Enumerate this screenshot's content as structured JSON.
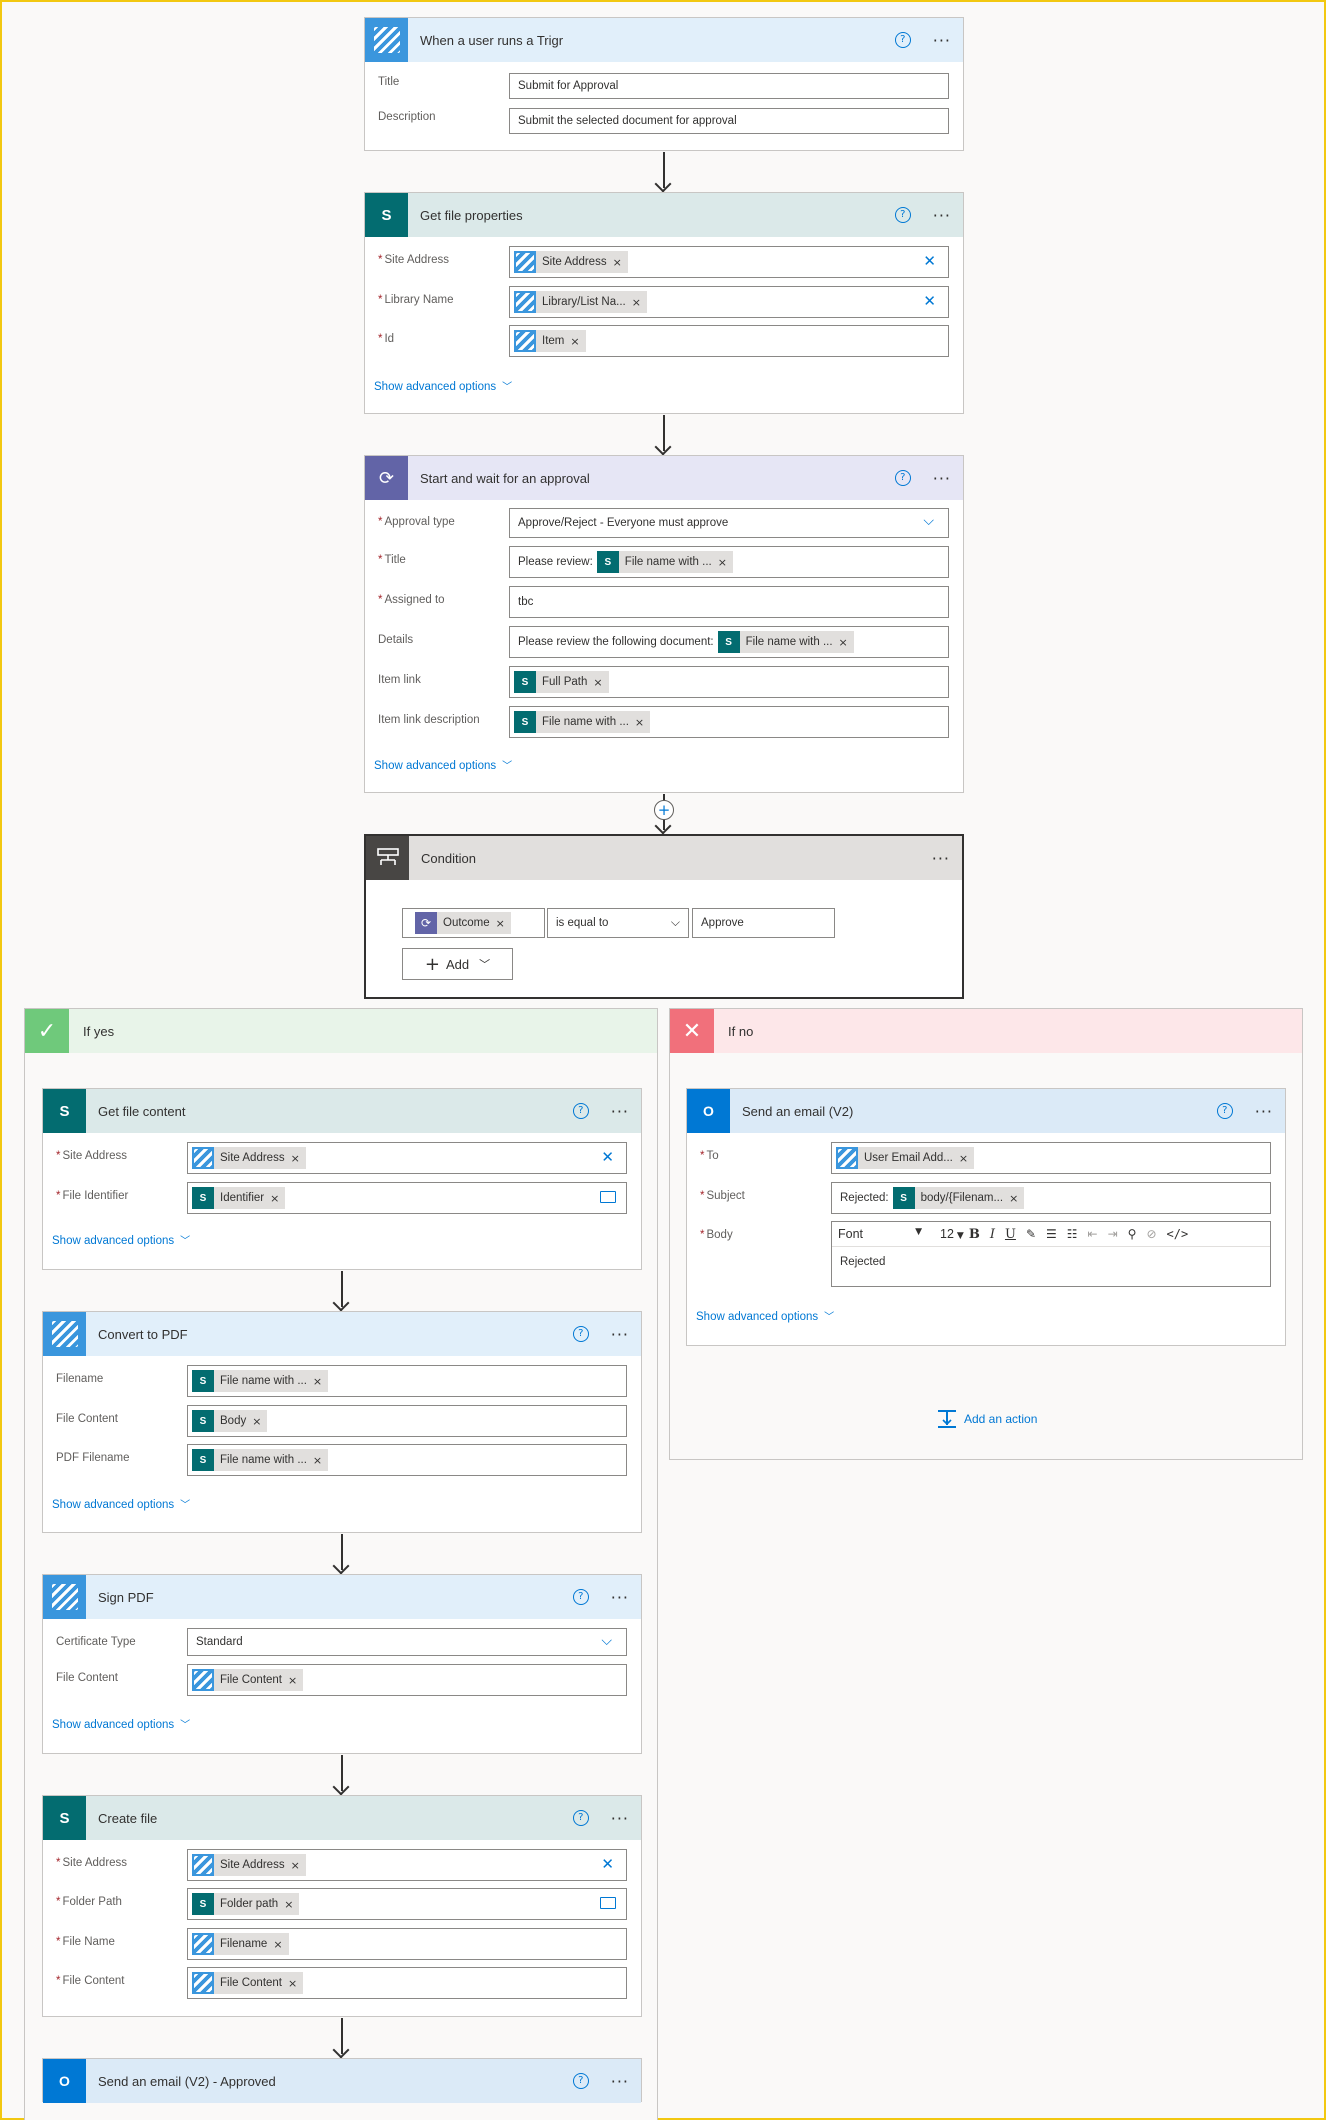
{
  "trigger": {
    "title": "When a user runs a Trigr",
    "fields": [
      {
        "label": "Title",
        "value": "Submit for Approval"
      },
      {
        "label": "Description",
        "value": "Submit the selected document for approval"
      }
    ]
  },
  "get_file_properties": {
    "title": "Get file properties",
    "fields": [
      {
        "label": "Site Address",
        "token": "Site Address"
      },
      {
        "label": "Library Name",
        "token": "Library/List Na..."
      },
      {
        "label": "Id",
        "token": "Item"
      }
    ],
    "advanced": "Show advanced options"
  },
  "approval": {
    "title": "Start and wait for an approval",
    "fields": [
      {
        "label": "Approval type",
        "value": "Approve/Reject - Everyone must approve"
      },
      {
        "label": "Title",
        "prefix": "Please review:",
        "token": "File name with ..."
      },
      {
        "label": "Assigned to",
        "value": "tbc"
      },
      {
        "label": "Details",
        "prefix": "Please review the following document:",
        "token": "File name with ..."
      },
      {
        "label": "Item link",
        "token": "Full Path"
      },
      {
        "label": "Item link description",
        "token": "File name with ..."
      }
    ],
    "advanced": "Show advanced options"
  },
  "condition": {
    "title": "Condition",
    "left_token": "Outcome",
    "operator": "is equal to",
    "right_value": "Approve",
    "add_label": "Add"
  },
  "if_yes": {
    "title": "If yes",
    "get_file_content": {
      "title": "Get file content",
      "fields": [
        {
          "label": "Site Address",
          "token": "Site Address"
        },
        {
          "label": "File Identifier",
          "token": "Identifier"
        }
      ],
      "advanced": "Show advanced options"
    },
    "convert_pdf": {
      "title": "Convert to PDF",
      "fields": [
        {
          "label": "Filename",
          "token": "File name with ..."
        },
        {
          "label": "File Content",
          "token": "Body"
        },
        {
          "label": "PDF Filename",
          "token": "File name with ..."
        }
      ],
      "advanced": "Show advanced options"
    },
    "sign_pdf": {
      "title": "Sign PDF",
      "fields": [
        {
          "label": "Certificate Type",
          "value": "Standard"
        },
        {
          "label": "File Content",
          "token": "File Content"
        }
      ],
      "advanced": "Show advanced options"
    },
    "create_file": {
      "title": "Create file",
      "fields": [
        {
          "label": "Site Address",
          "token": "Site Address"
        },
        {
          "label": "Folder Path",
          "token": "Folder path"
        },
        {
          "label": "File Name",
          "token": "Filename"
        },
        {
          "label": "File Content",
          "token": "File Content"
        }
      ]
    },
    "send_email_approved": {
      "title": "Send an email (V2) - Approved"
    }
  },
  "if_no": {
    "title": "If no",
    "send_email": {
      "title": "Send an email (V2)",
      "fields": [
        {
          "label": "To",
          "token": "User Email Add..."
        },
        {
          "label": "Subject",
          "prefix": "Rejected:",
          "token": "body/{Filenam..."
        },
        {
          "label": "Body",
          "font": "Font",
          "size": "12",
          "value": "Rejected"
        }
      ],
      "advanced": "Show advanced options"
    },
    "add_action": "Add an action"
  },
  "colors": {
    "trigr": "#3a96dd",
    "sharepoint": "#036c70",
    "approvals": "#6264a7",
    "outlook": "#0078d4",
    "yes_head": "#e8f4e9",
    "no_head": "#fde7e9",
    "link": "#0078d4"
  }
}
